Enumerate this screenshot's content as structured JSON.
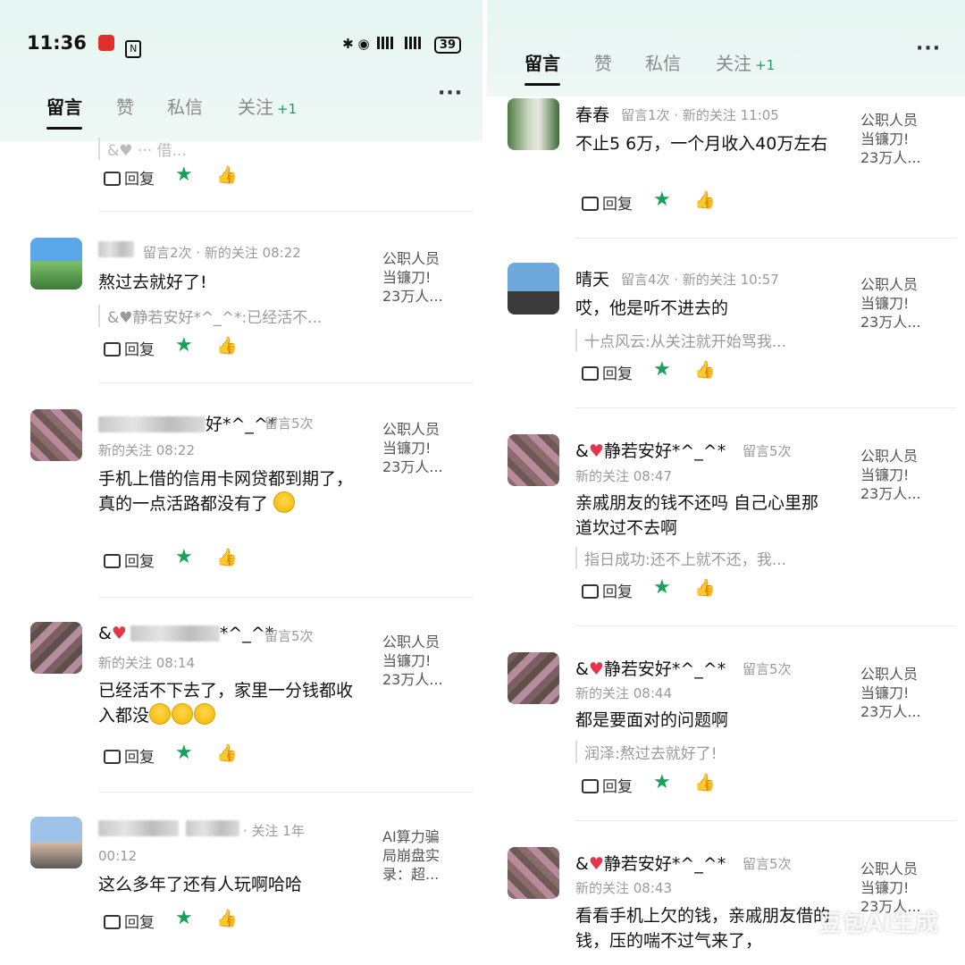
{
  "status_bar": {
    "time": "11:36",
    "battery": "39"
  },
  "tabs": [
    {
      "label": "留言"
    },
    {
      "label": "赞"
    },
    {
      "label": "私信"
    },
    {
      "label": "关注",
      "badge": "+1"
    }
  ],
  "more_label": "···",
  "actions": {
    "reply": "回复",
    "star": "★",
    "like": "👍"
  },
  "left_items": [
    {
      "text": "",
      "quote": "&♥ ··· 借..."
    },
    {
      "name": "",
      "meta": "留言2次 · 新的关注 08:22",
      "text": "熬过去就好了!",
      "quote": "&♥静若安好*^_^*:已经活不...",
      "side": [
        "公职人员",
        "当镰刀!",
        "23万人..."
      ]
    },
    {
      "name_suffix": "好*^_^*",
      "meta_inline": "留言5次",
      "meta": "新的关注 08:22",
      "text": "手机上借的信用卡网贷都到期了，真的一点活路都没有了",
      "side": [
        "公职人员",
        "当镰刀!",
        "23万人..."
      ]
    },
    {
      "name_prefix": "&",
      "name_suffix": "*^_^*",
      "meta_inline": "留言5次",
      "meta": "新的关注 08:14",
      "text": "已经活不下去了，家里一分钱都收入都没",
      "side": [
        "公职人员",
        "当镰刀!",
        "23万人..."
      ]
    },
    {
      "meta_inline": "· 关注 1年",
      "meta": "00:12",
      "text": "这么多年了还有人玩啊哈哈",
      "side": [
        "AI算力骗",
        "局崩盘实",
        "录：超..."
      ]
    }
  ],
  "right_items": [
    {
      "name": "春春",
      "meta": "留言1次 · 新的关注 11:05",
      "text": "不止5 6万，一个月收入40万左右",
      "side": [
        "公职人员",
        "当镰刀!",
        "23万人..."
      ]
    },
    {
      "name": "晴天",
      "meta": "留言4次 · 新的关注 10:57",
      "text": "哎，他是听不进去的",
      "quote": "十点风云:从关注就开始骂我...",
      "side": [
        "公职人员",
        "当镰刀!",
        "23万人..."
      ]
    },
    {
      "name": "&♥静若安好*^_^*",
      "meta_inline": "留言5次",
      "meta": "新的关注 08:47",
      "text": "亲戚朋友的钱不还吗  自己心里那道坎过不去啊",
      "quote": "指日成功:还不上就不还，我...",
      "side": [
        "公职人员",
        "当镰刀!",
        "23万人..."
      ]
    },
    {
      "name": "&♥静若安好*^_^*",
      "meta_inline": "留言5次",
      "meta": "新的关注 08:44",
      "text": "都是要面对的问题啊",
      "quote": "润泽:熬过去就好了!",
      "side": [
        "公职人员",
        "当镰刀!",
        "23万人..."
      ]
    },
    {
      "name": "&♥静若安好*^_^*",
      "meta_inline": "留言5次",
      "meta": "新的关注 08:43",
      "text": "看看手机上欠的钱，亲戚朋友借的钱，压的喘不过气来了，",
      "side": [
        "公职人员",
        "当镰刀!",
        "23万人..."
      ]
    }
  ],
  "watermark": "豆包AI生成",
  "colors": {
    "accent": "#1aa05b",
    "header_bg": "#e6f5f1",
    "heart": "#e8344a"
  }
}
